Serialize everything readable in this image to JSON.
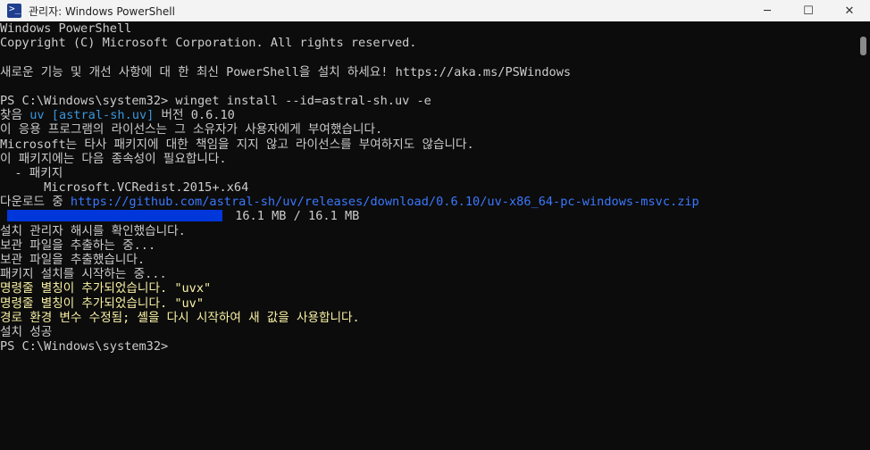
{
  "window": {
    "title": "관리자: Windows PowerShell",
    "app_icon": "powershell-icon"
  },
  "controls": {
    "minimize": "─",
    "maximize": "☐",
    "close": "✕"
  },
  "terminal": {
    "header1": "Windows PowerShell",
    "header2": "Copyright (C) Microsoft Corporation. All rights reserved.",
    "notice": "새로운 기능 및 개선 사항에 대 한 최신 PowerShell을 설치 하세요! https://aka.ms/PSWindows",
    "prompt1": "PS C:\\Windows\\system32> ",
    "command": "winget install --id=astral-sh.uv -e",
    "found_prefix": "찾음 ",
    "found_pkg": "uv [astral-sh.uv]",
    "found_suffix": " 버전 0.6.10",
    "license1": "이 응용 프로그램의 라이선스는 그 소유자가 사용자에게 부여했습니다.",
    "license2": "Microsoft는 타사 패키지에 대한 책임을 지지 않고 라이선스를 부여하지도 않습니다.",
    "deps_header": "이 패키지에는 다음 종속성이 필요합니다.",
    "deps_item": "  - 패키지",
    "deps_value": "      Microsoft.VCRedist.2015+.x64",
    "download_prefix": "다운로드 중 ",
    "download_url": "https://github.com/astral-sh/uv/releases/download/0.6.10/uv-x86_64-pc-windows-msvc.zip",
    "progress_text": "16.1 MB / 16.1 MB",
    "progress_fraction": 1.0,
    "hash_ok": "설치 관리자 해시를 확인했습니다.",
    "extracting": "보관 파일을 추출하는 중...",
    "extracted": "보관 파일을 추출했습니다.",
    "installing": "패키지 설치를 시작하는 중...",
    "alias_uvx": "명령줄 별칭이 추가되었습니다. \"uvx\"",
    "alias_uv": "명령줄 별칭이 추가되었습니다. \"uv\"",
    "path_changed": "경로 환경 변수 수정됨; 셸을 다시 시작하여 새 값을 사용합니다.",
    "success": "설치 성공",
    "prompt2": "PS C:\\Windows\\system32>"
  },
  "colors": {
    "background": "#0c0c0c",
    "text": "#cccccc",
    "link": "#3b78ff",
    "highlight": "#f9f1a5",
    "progress": "#0037da"
  }
}
